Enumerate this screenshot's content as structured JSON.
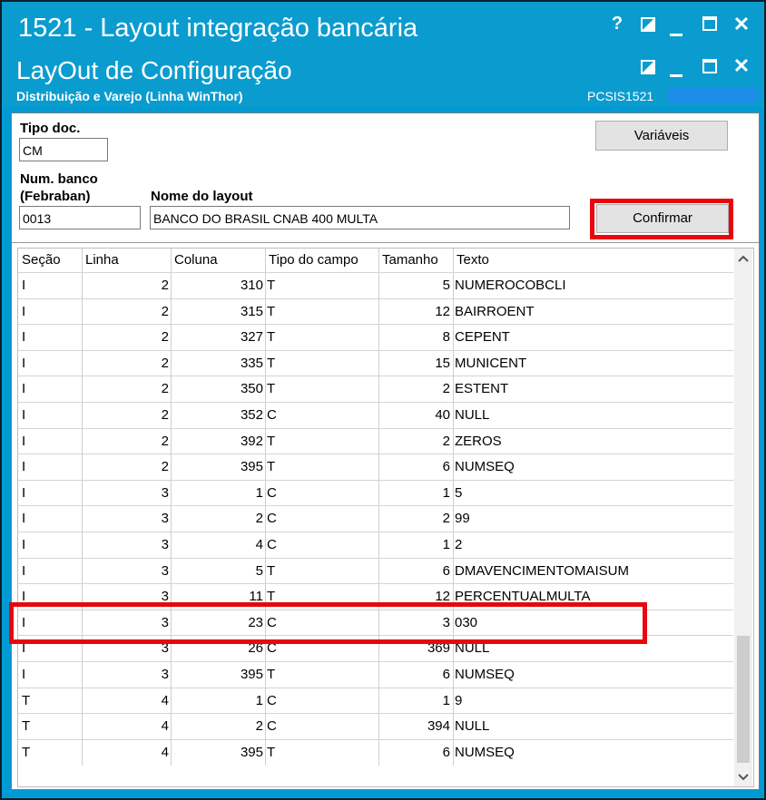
{
  "window": {
    "title": "1521 - Layout integração bancária",
    "controls": {
      "help": "?",
      "restore": "◪",
      "minimize": "_",
      "maximize": "☐",
      "close": "✕"
    }
  },
  "subwindow": {
    "title": "LayOut de Configuração",
    "subtitle": "Distribuição e Varejo (Linha WinThor)",
    "code": "PCSIS1521"
  },
  "form": {
    "tipo_doc_label": "Tipo doc.",
    "tipo_doc_value": "CM",
    "num_banco_label_1": "Num. banco",
    "num_banco_label_2": "(Febraban)",
    "num_banco_value": "0013",
    "nome_layout_label": "Nome do layout",
    "nome_layout_value": "BANCO DO BRASIL CNAB 400  MULTA",
    "variaveis_button": "Variáveis",
    "confirmar_button": "Confirmar"
  },
  "table": {
    "columns": [
      "Seção",
      "Linha",
      "Coluna",
      "Tipo do campo",
      "Tamanho",
      "Texto"
    ],
    "rows": [
      [
        "I",
        "2",
        "310",
        "T",
        "5",
        "NUMEROCOBCLI"
      ],
      [
        "I",
        "2",
        "315",
        "T",
        "12",
        "BAIRROENT"
      ],
      [
        "I",
        "2",
        "327",
        "T",
        "8",
        "CEPENT"
      ],
      [
        "I",
        "2",
        "335",
        "T",
        "15",
        "MUNICENT"
      ],
      [
        "I",
        "2",
        "350",
        "T",
        "2",
        "ESTENT"
      ],
      [
        "I",
        "2",
        "352",
        "C",
        "40",
        "NULL"
      ],
      [
        "I",
        "2",
        "392",
        "T",
        "2",
        "ZEROS"
      ],
      [
        "I",
        "2",
        "395",
        "T",
        "6",
        "NUMSEQ"
      ],
      [
        "I",
        "3",
        "1",
        "C",
        "1",
        "5"
      ],
      [
        "I",
        "3",
        "2",
        "C",
        "2",
        "99"
      ],
      [
        "I",
        "3",
        "4",
        "C",
        "1",
        "2"
      ],
      [
        "I",
        "3",
        "5",
        "T",
        "6",
        "DMAVENCIMENTOMAISUM"
      ],
      [
        "I",
        "3",
        "11",
        "T",
        "12",
        "PERCENTUALMULTA"
      ],
      [
        "I",
        "3",
        "23",
        "C",
        "3",
        "030"
      ],
      [
        "I",
        "3",
        "26",
        "C",
        "369",
        "NULL"
      ],
      [
        "I",
        "3",
        "395",
        "T",
        "6",
        "NUMSEQ"
      ],
      [
        "T",
        "4",
        "1",
        "C",
        "1",
        "9"
      ],
      [
        "T",
        "4",
        "2",
        "C",
        "394",
        "NULL"
      ],
      [
        "T",
        "4",
        "395",
        "T",
        "6",
        "NUMSEQ"
      ]
    ],
    "highlighted_row_index": 13
  },
  "scrollbar": {
    "up": "▲",
    "down": "▼"
  },
  "colors": {
    "titlebar": "#0b9ccf",
    "highlight": "#e8070e"
  }
}
